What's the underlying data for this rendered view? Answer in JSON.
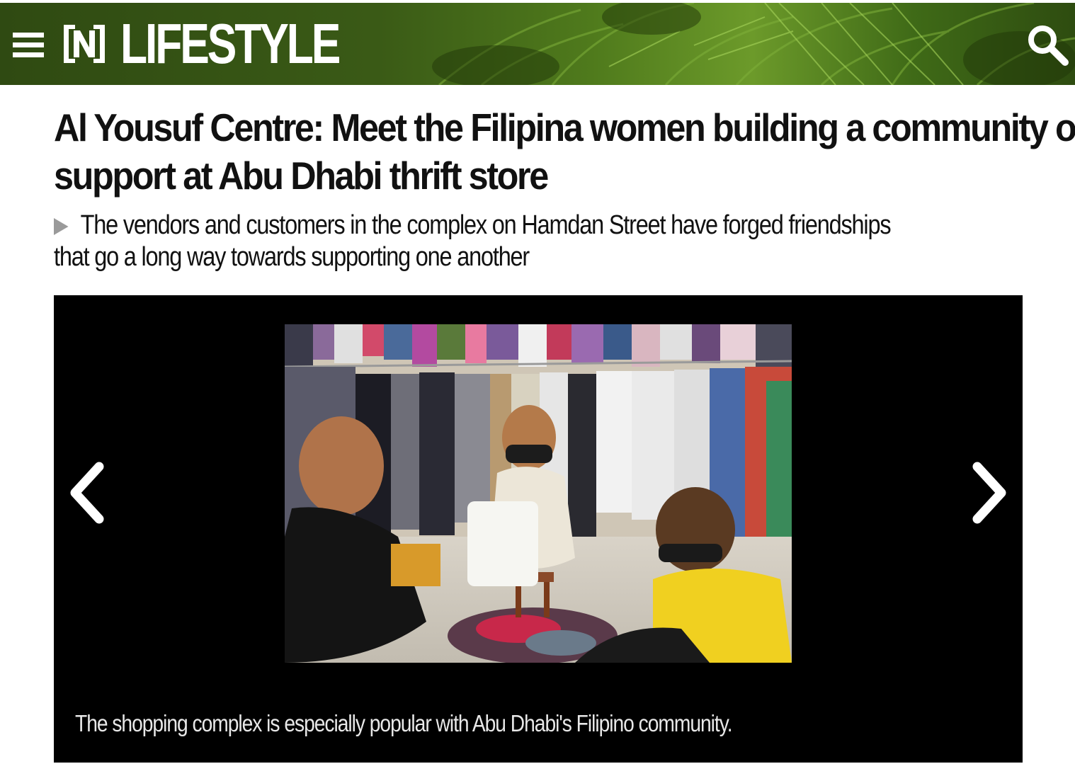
{
  "header": {
    "section_title": "LIFESTYLE",
    "logo_mark": "N",
    "menu_icon": "hamburger-menu-icon",
    "search_icon": "search-icon",
    "background_color": "#3a5a16"
  },
  "article": {
    "headline_lines": [
      "Al Yousuf Centre: Meet the Filipina women building a community of",
      "support at Abu Dhabi thrift store"
    ],
    "standfirst_lines": [
      "The vendors and customers in the complex on Hamdan Street have forged friendships",
      "that go a long way towards supporting one another"
    ]
  },
  "gallery": {
    "caption": "The shopping complex is especially popular with Abu Dhabi's Filipino community.",
    "prev_icon": "chevron-left-icon",
    "next_icon": "chevron-right-icon",
    "background_color": "#000000"
  }
}
